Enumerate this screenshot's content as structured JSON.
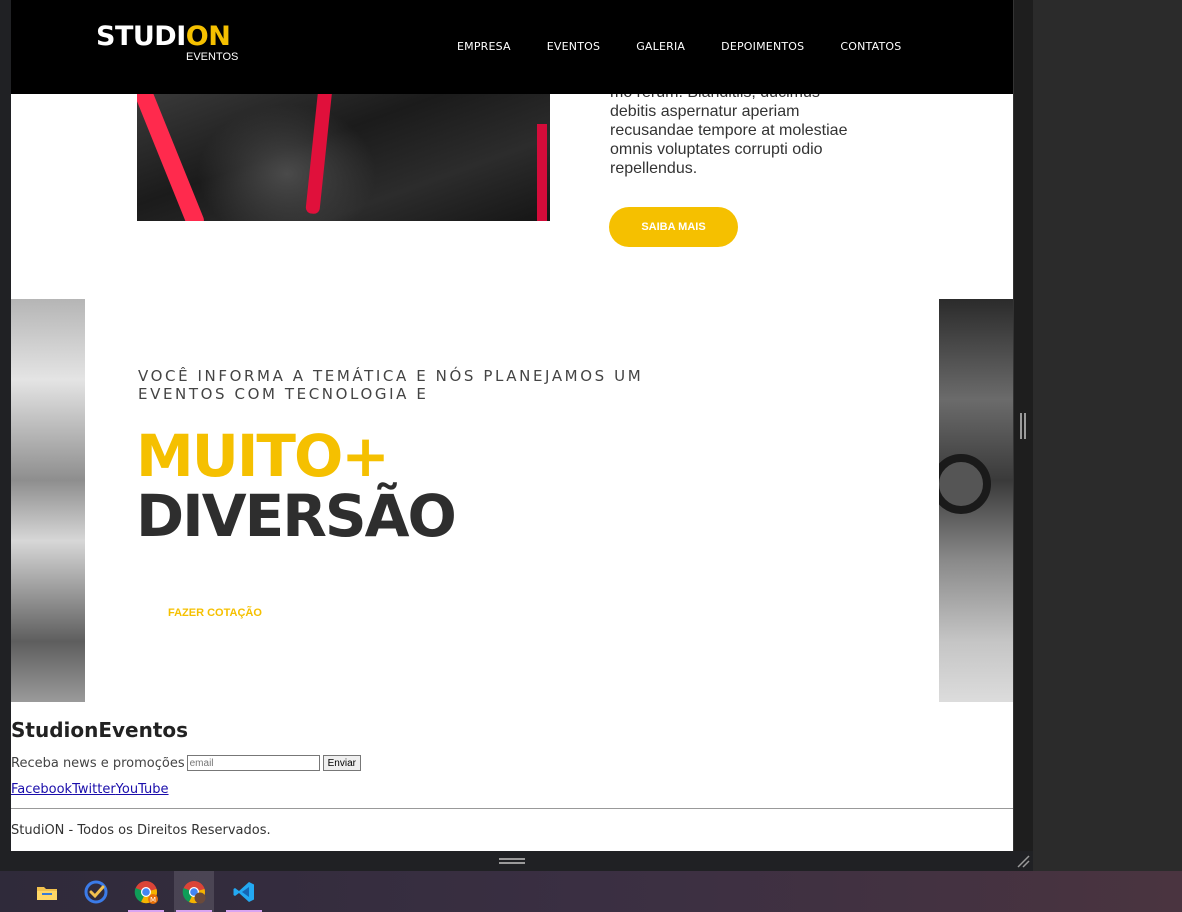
{
  "header": {
    "logo_main": "STUDI",
    "logo_accent": "ON",
    "logo_sub": "EVENTOS",
    "nav": [
      "EMPRESA",
      "EVENTOS",
      "GALERIA",
      "DEPOIMENTOS",
      "CONTATOS"
    ]
  },
  "about": {
    "text": "mo rerum. Blanditiis, ducimus debitis aspernatur aperiam recusandae tempore at molestiae omnis voluptates corrupti odio repellendus.",
    "button_label": "SAIBA MAIS"
  },
  "hero": {
    "kicker": "VOCÊ INFORMA A TEMÁTICA E NÓS PLANEJAMOS UM EVENTOS COM TECNOLOGIA E",
    "big_line_1": "MUITO+",
    "big_line_2": "DIVERSÃO",
    "button_label": "FAZER COTAÇÃO"
  },
  "footer": {
    "brand": "StudionEventos",
    "newsletter_label": "Receba news e promoções",
    "email_placeholder": "email",
    "submit_label": "Enviar",
    "social_links": [
      "Facebook",
      "Twitter",
      "YouTube"
    ],
    "copyright": "StudiON - Todos os Direitos Reservados."
  },
  "taskbar": {
    "apps": [
      "file-explorer-icon",
      "todo-icon",
      "chrome-icon",
      "chrome-profile-icon",
      "vscode-icon"
    ]
  },
  "colors": {
    "accent": "#f5c000",
    "header_bg": "#000000",
    "text_dark": "#2e2e2e"
  }
}
